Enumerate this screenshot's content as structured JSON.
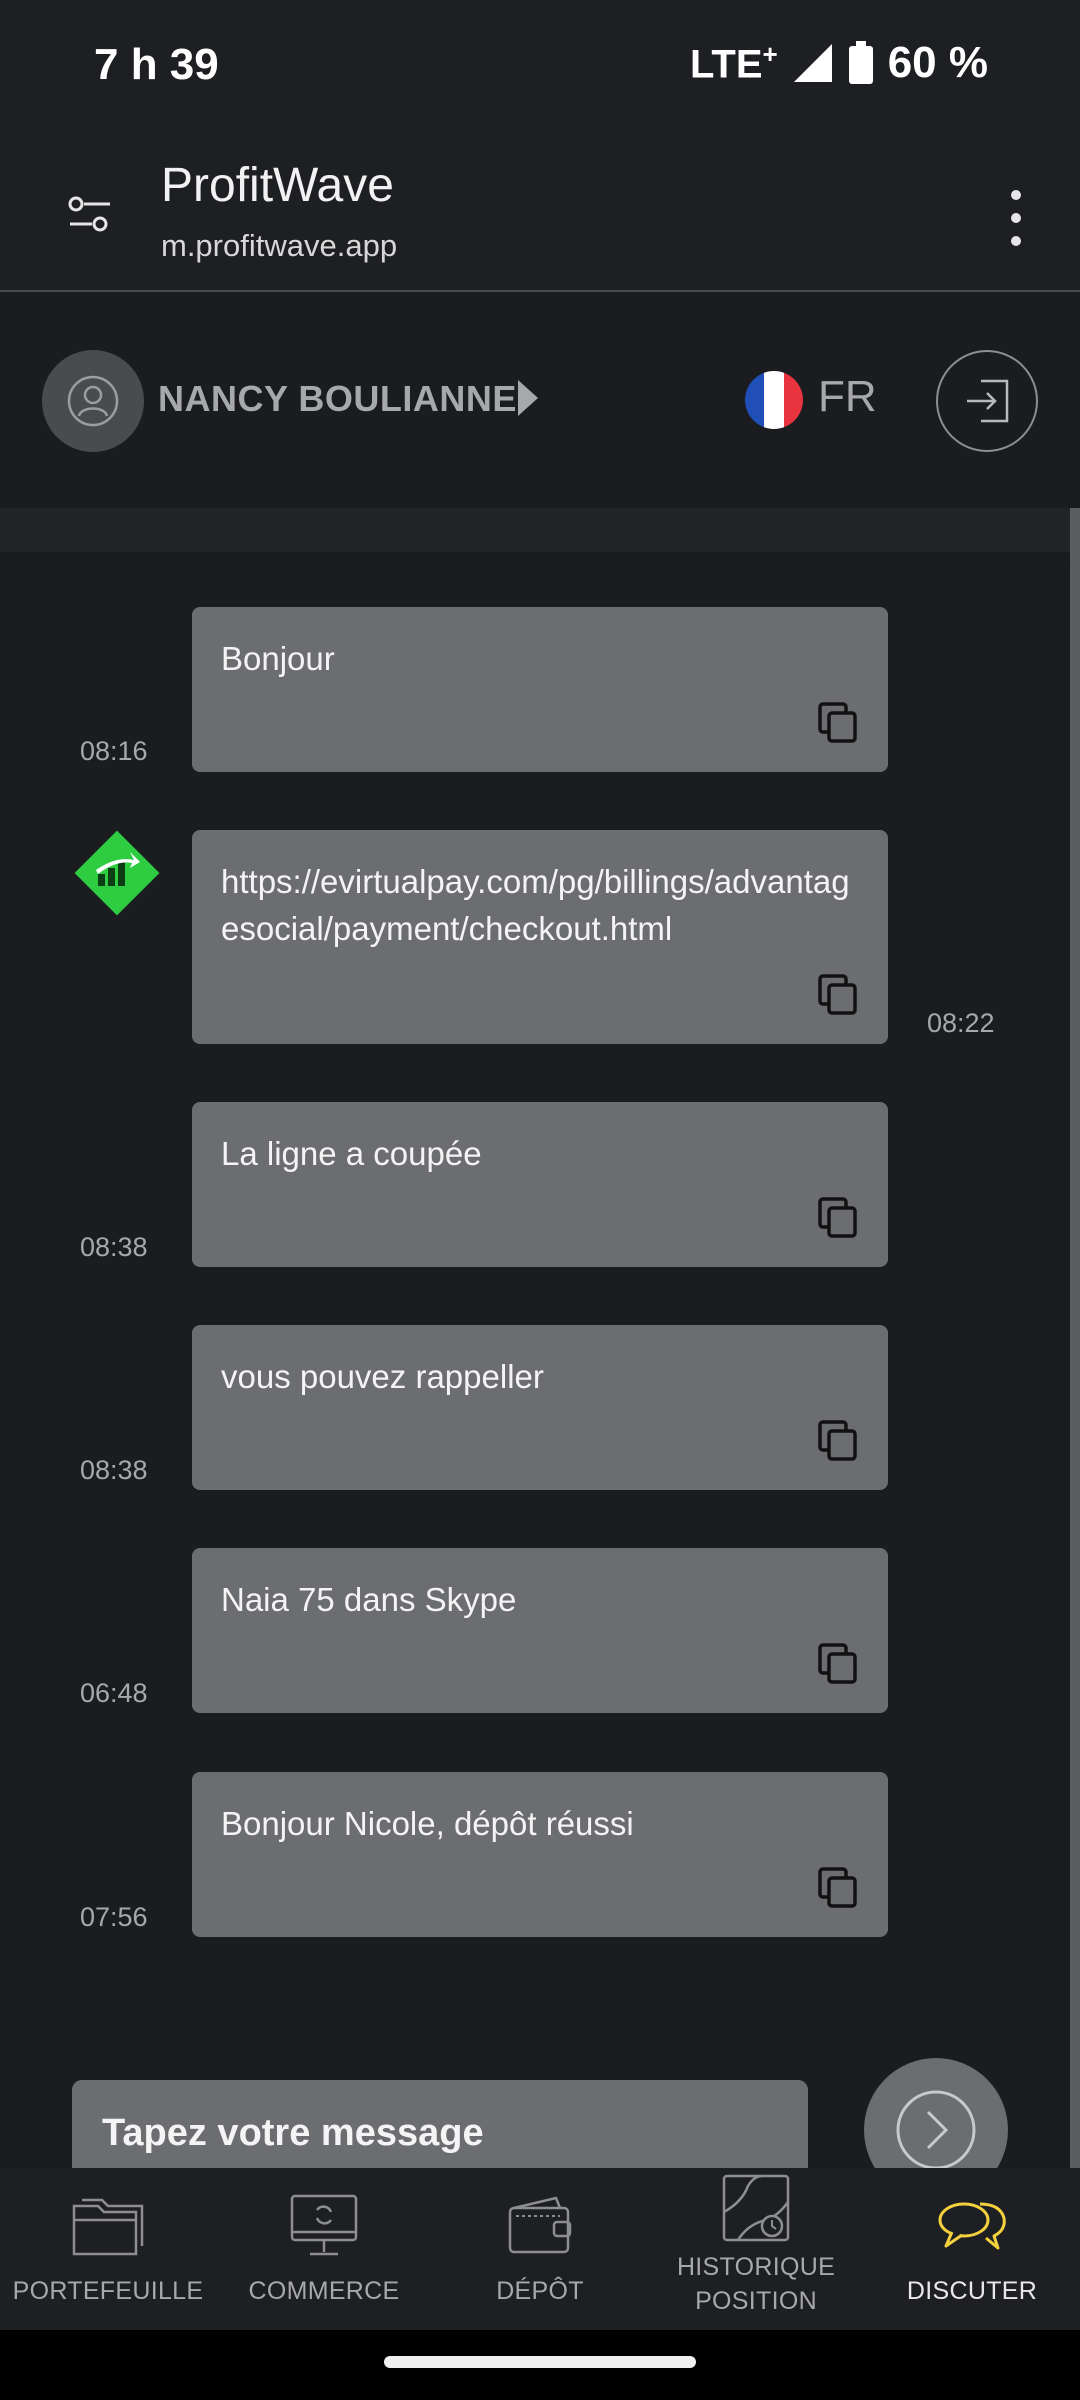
{
  "status_bar": {
    "time": "7 h 39",
    "network": "LTE",
    "network_sup": "+",
    "battery": "60 %"
  },
  "browser": {
    "title": "ProfitWave",
    "url": "m.profitwave.app"
  },
  "user": {
    "name": "NANCY BOULIANNE",
    "language": "FR"
  },
  "messages": [
    {
      "text": "Bonjour",
      "time": "08:16",
      "side": "left"
    },
    {
      "text": "https://evirtualpay.com/pg/billings/advantagesocial/payment/checkout.html",
      "time": "08:22",
      "side": "right"
    },
    {
      "text": "La ligne a coupée",
      "time": "08:38",
      "side": "left"
    },
    {
      "text": "vous pouvez rappeller",
      "time": "08:38",
      "side": "left"
    },
    {
      "text": "Naia 75 dans Skype",
      "time": "06:48",
      "side": "left"
    },
    {
      "text": "Bonjour Nicole, dépôt réussi",
      "time": "07:56",
      "side": "left"
    }
  ],
  "composer": {
    "placeholder": "Tapez votre message"
  },
  "nav": {
    "items": [
      {
        "label": "PORTEFEUILLE",
        "icon": "folder-icon"
      },
      {
        "label": "COMMERCE",
        "icon": "monitor-icon"
      },
      {
        "label": "DÉPÔT",
        "icon": "wallet-icon"
      },
      {
        "label_line1": "HISTORIQUE",
        "label_line2": "POSITION",
        "icon": "map-history-icon"
      },
      {
        "label": "DISCUTER",
        "icon": "chat-bubbles-icon",
        "active": true
      }
    ]
  },
  "colors": {
    "accent": "#f4d03f",
    "bubble": "#6c6d71",
    "background": "#1b1c20",
    "brand_green": "#2ecc40"
  }
}
